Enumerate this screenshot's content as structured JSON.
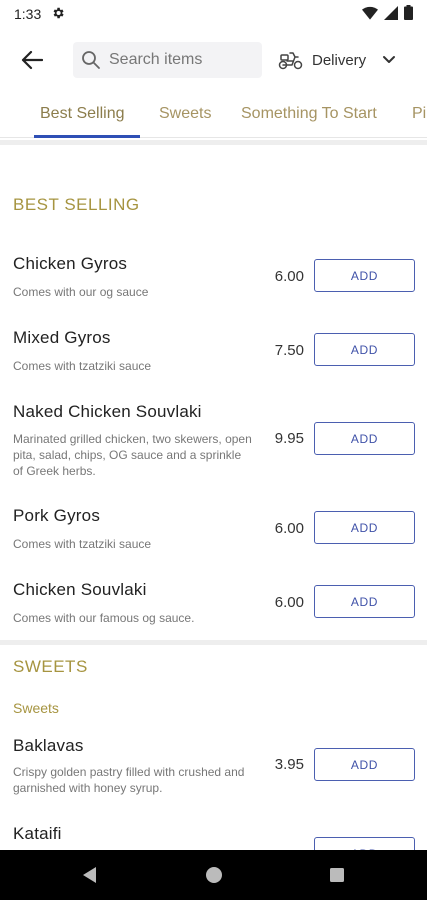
{
  "status_bar": {
    "time": "1:33"
  },
  "header": {
    "search_placeholder": "Search items",
    "delivery_label": "Delivery"
  },
  "tabs": [
    {
      "label": "Best Selling",
      "active": true
    },
    {
      "label": "Sweets",
      "active": false
    },
    {
      "label": "Something To Start",
      "active": false
    },
    {
      "label": "Pi",
      "active": false
    }
  ],
  "sections": {
    "best_selling": {
      "title": "BEST SELLING",
      "items": [
        {
          "name": "Chicken Gyros",
          "desc": "Comes with our og sauce",
          "price": "6.00",
          "button": "ADD"
        },
        {
          "name": "Mixed Gyros",
          "desc": "Comes with tzatziki sauce",
          "price": "7.50",
          "button": "ADD"
        },
        {
          "name": "Naked Chicken Souvlaki",
          "desc": "Marinated grilled chicken, two skewers, open pita, salad, chips, OG sauce and a sprinkle of Greek herbs.",
          "price": "9.95",
          "button": "ADD"
        },
        {
          "name": "Pork Gyros",
          "desc": "Comes with tzatziki sauce",
          "price": "6.00",
          "button": "ADD"
        },
        {
          "name": "Chicken Souvlaki",
          "desc": "Comes with our famous og sauce.",
          "price": "6.00",
          "button": "ADD"
        }
      ]
    },
    "sweets": {
      "title": "SWEETS",
      "subtitle": "Sweets",
      "items": [
        {
          "name": "Baklavas",
          "desc": "Crispy golden pastry filled with crushed and garnished with honey syrup.",
          "price": "3.95",
          "button": "ADD"
        },
        {
          "name": "Kataifi",
          "desc": "",
          "price": "",
          "button": "ADD"
        }
      ]
    }
  },
  "colors": {
    "accent_gold": "#a69440",
    "button_blue": "#3f51a8",
    "tab_underline": "#2f4fb5"
  }
}
